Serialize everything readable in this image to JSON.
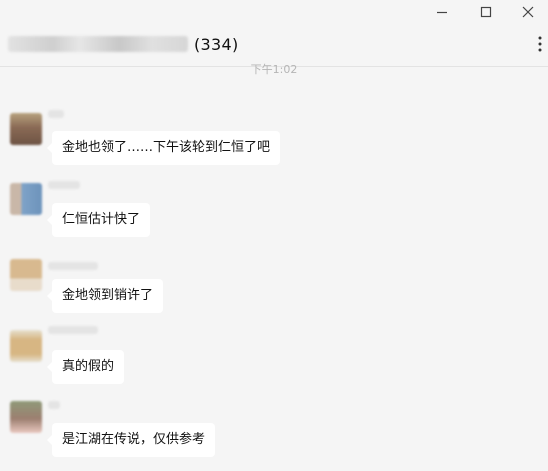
{
  "header": {
    "count": "(334)",
    "more_icon": "more-icon"
  },
  "window": {
    "minimize_icon": "minimize-icon",
    "maximize_icon": "maximize-icon",
    "close_icon": "close-icon"
  },
  "timestamp": "下午1:02",
  "messages": [
    {
      "text": "金地也领了……下午该轮到仁恒了吧",
      "avatar_colors": [
        "#8a6a55",
        "#b7a27e"
      ]
    },
    {
      "text": "仁恒估计快了",
      "avatar_colors": [
        "#7fa3c8",
        "#c9b7a8"
      ]
    },
    {
      "text": "金地领到销许了",
      "avatar_colors": [
        "#d8b98f",
        "#e8dccb"
      ]
    },
    {
      "text": "真的假的",
      "avatar_colors": [
        "#d7b683",
        "#e6e0cf"
      ]
    },
    {
      "text": "是江湖在传说，仅供参考",
      "avatar_colors": [
        "#9c7f70",
        "#8f9a79"
      ]
    }
  ]
}
